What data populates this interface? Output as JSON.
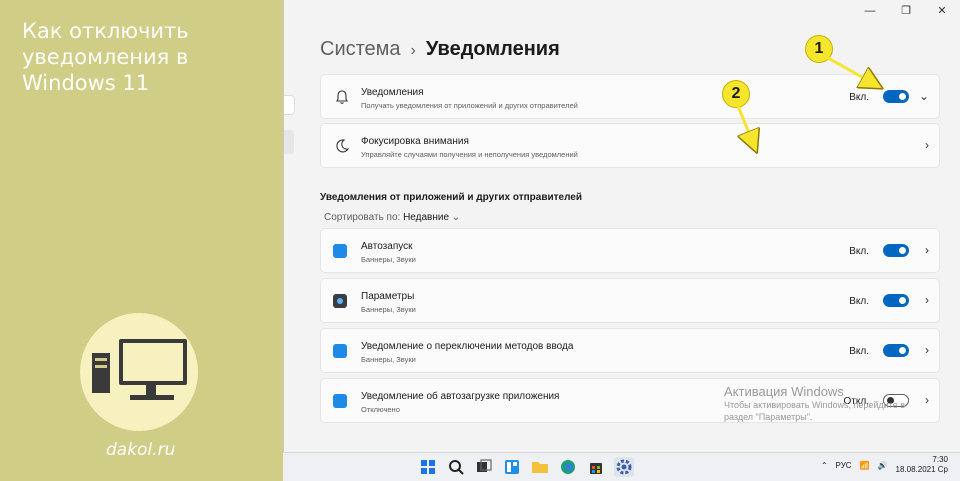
{
  "article": {
    "title": "Как отключить уведомления в Windows 11",
    "site": "dakol.ru"
  },
  "window": {
    "controls": [
      "minimize",
      "maximize",
      "close"
    ],
    "breadcrumb": {
      "parent": "Система",
      "separator": "›",
      "current": "Уведомления"
    }
  },
  "top_cards": [
    {
      "title": "Уведомления",
      "subtitle": "Получать уведомления от приложений и других отправителей",
      "state": "Вкл.",
      "toggle_on": true,
      "chevron": "⌄"
    },
    {
      "title": "Фокусировка внимания",
      "subtitle": "Управляйте случаями получения и неполучения уведомлений",
      "chevron": "›"
    }
  ],
  "section": {
    "title": "Уведомления от приложений и других отправителей",
    "sort_label": "Сортировать по:",
    "sort_value": "Недавние"
  },
  "apps": [
    {
      "title": "Автозапуск",
      "subtitle": "Баннеры, Звуки",
      "state": "Вкл.",
      "toggle_on": true,
      "icon": "autoplay-icon"
    },
    {
      "title": "Параметры",
      "subtitle": "Баннеры, Звуки",
      "state": "Вкл.",
      "toggle_on": true,
      "icon": "settings-app-icon"
    },
    {
      "title": "Уведомление о переключении методов ввода",
      "subtitle": "Баннеры, Звуки",
      "state": "Вкл.",
      "toggle_on": true,
      "icon": "input-switch-icon"
    },
    {
      "title": "Уведомление об автозагрузке приложения",
      "subtitle": "Отключено",
      "state": "Откл.",
      "toggle_on": false,
      "icon": "startup-app-icon"
    }
  ],
  "activation": {
    "heading": "Активация Windows",
    "text": "Чтобы активировать Windows, перейдите в раздел \"Параметры\"."
  },
  "taskbar": {
    "language": "РУС",
    "time": "7:30",
    "date": "18.08.2021 Ср",
    "up_arrow": "⌃"
  },
  "callouts": [
    "1",
    "2"
  ],
  "colors": {
    "accent": "#0067c0",
    "callout": "#f5e52c",
    "background": "#cfcd86"
  }
}
